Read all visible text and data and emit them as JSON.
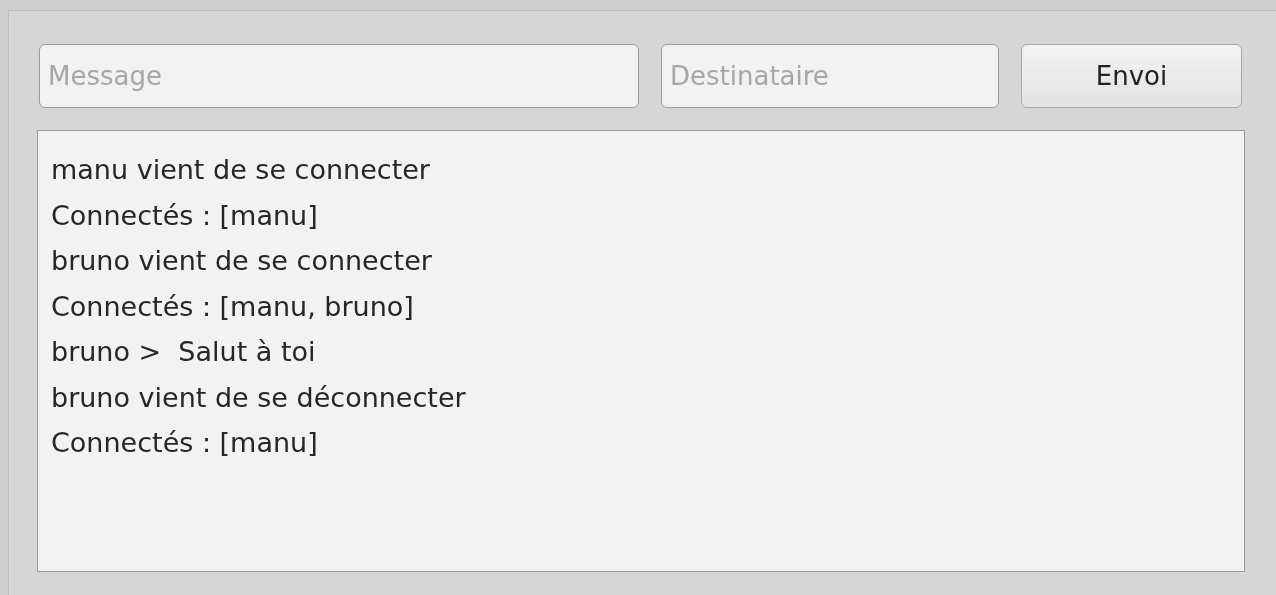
{
  "message_field": {
    "placeholder": "Message"
  },
  "recipient_field": {
    "placeholder": "Destinataire"
  },
  "send_button": {
    "label": "Envoi"
  },
  "log": [
    "manu vient de se connecter",
    "Connectés : [manu]",
    "bruno vient de se connecter",
    "Connectés : [manu, bruno]",
    "bruno >  Salut à toi",
    "bruno vient de se déconnecter",
    "Connectés : [manu]"
  ]
}
